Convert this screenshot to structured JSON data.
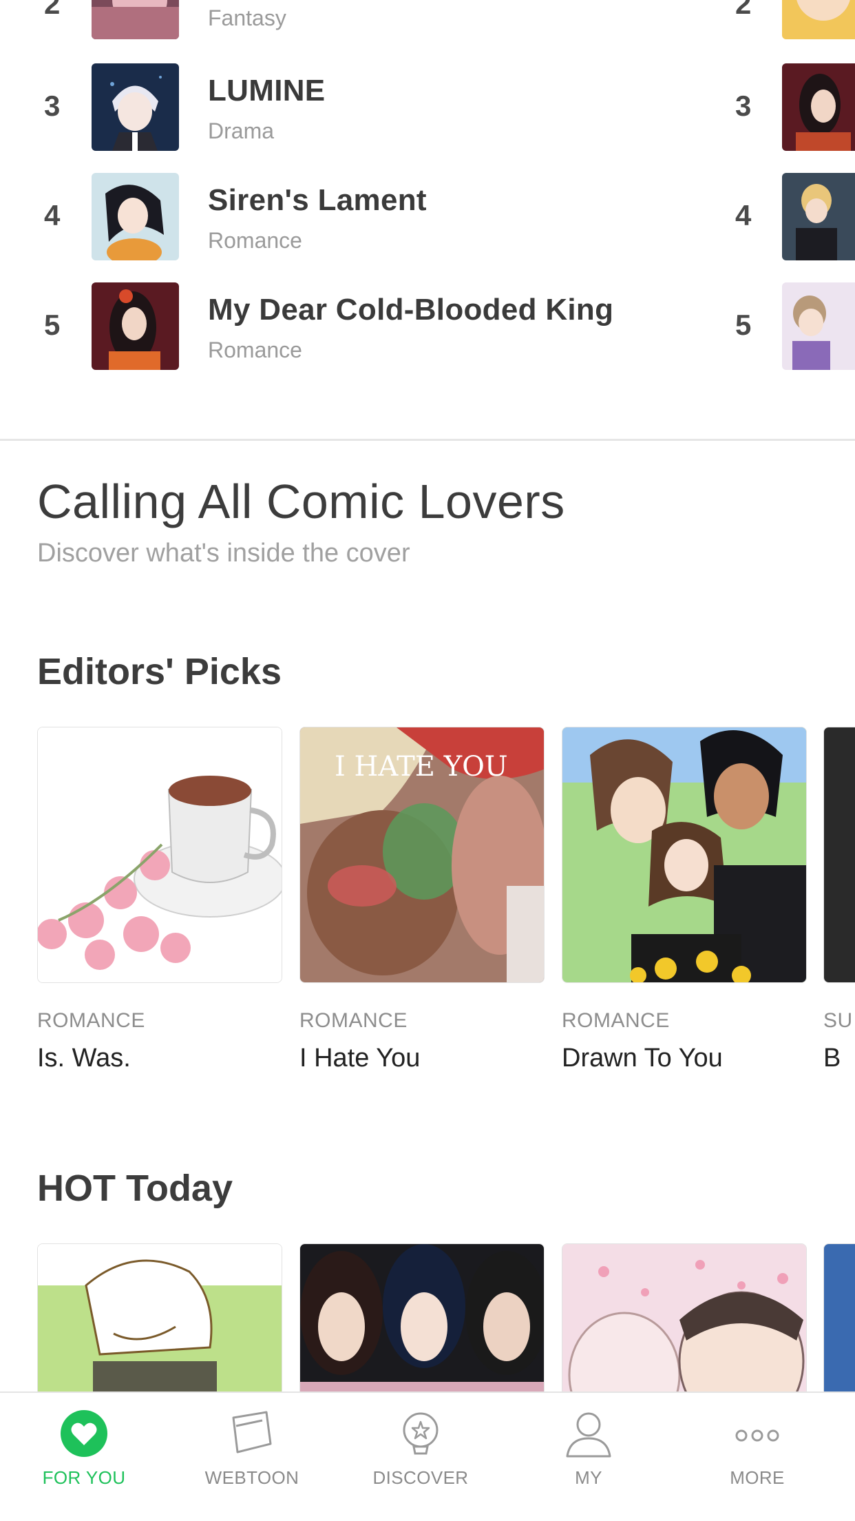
{
  "ranking": {
    "partial_row": {
      "genre": "Fantasy"
    },
    "rows": [
      {
        "rank": "3",
        "title": "LUMINE",
        "genre": "Drama"
      },
      {
        "rank": "4",
        "title": "Siren's Lament",
        "genre": "Romance"
      },
      {
        "rank": "5",
        "title": "My Dear Cold-Blooded King",
        "genre": "Romance"
      }
    ],
    "right_column_ranks": [
      "2",
      "3",
      "4",
      "5"
    ]
  },
  "banner": {
    "title": "Calling All Comic Lovers",
    "subtitle": "Discover what's inside the cover"
  },
  "editors_picks": {
    "title": "Editors' Picks",
    "cards": [
      {
        "genre": "ROMANCE",
        "title": "Is. Was."
      },
      {
        "genre": "ROMANCE",
        "title": "I Hate You",
        "cover_text": "I HATE YOU"
      },
      {
        "genre": "ROMANCE",
        "title": "Drawn To You"
      },
      {
        "genre": "SU",
        "title": "B"
      }
    ]
  },
  "hot_today": {
    "title": "HOT Today"
  },
  "tabbar": {
    "tabs": [
      {
        "label": "FOR YOU",
        "icon": "heart-icon",
        "active": true
      },
      {
        "label": "WEBTOON",
        "icon": "webtoon-icon",
        "active": false
      },
      {
        "label": "DISCOVER",
        "icon": "discover-icon",
        "active": false
      },
      {
        "label": "MY",
        "icon": "user-icon",
        "active": false
      },
      {
        "label": "MORE",
        "icon": "more-icon",
        "active": false
      }
    ]
  },
  "colors": {
    "accent": "#1ec15a",
    "text_dark": "#3c3c3c",
    "text_muted": "#9a9a9a"
  }
}
